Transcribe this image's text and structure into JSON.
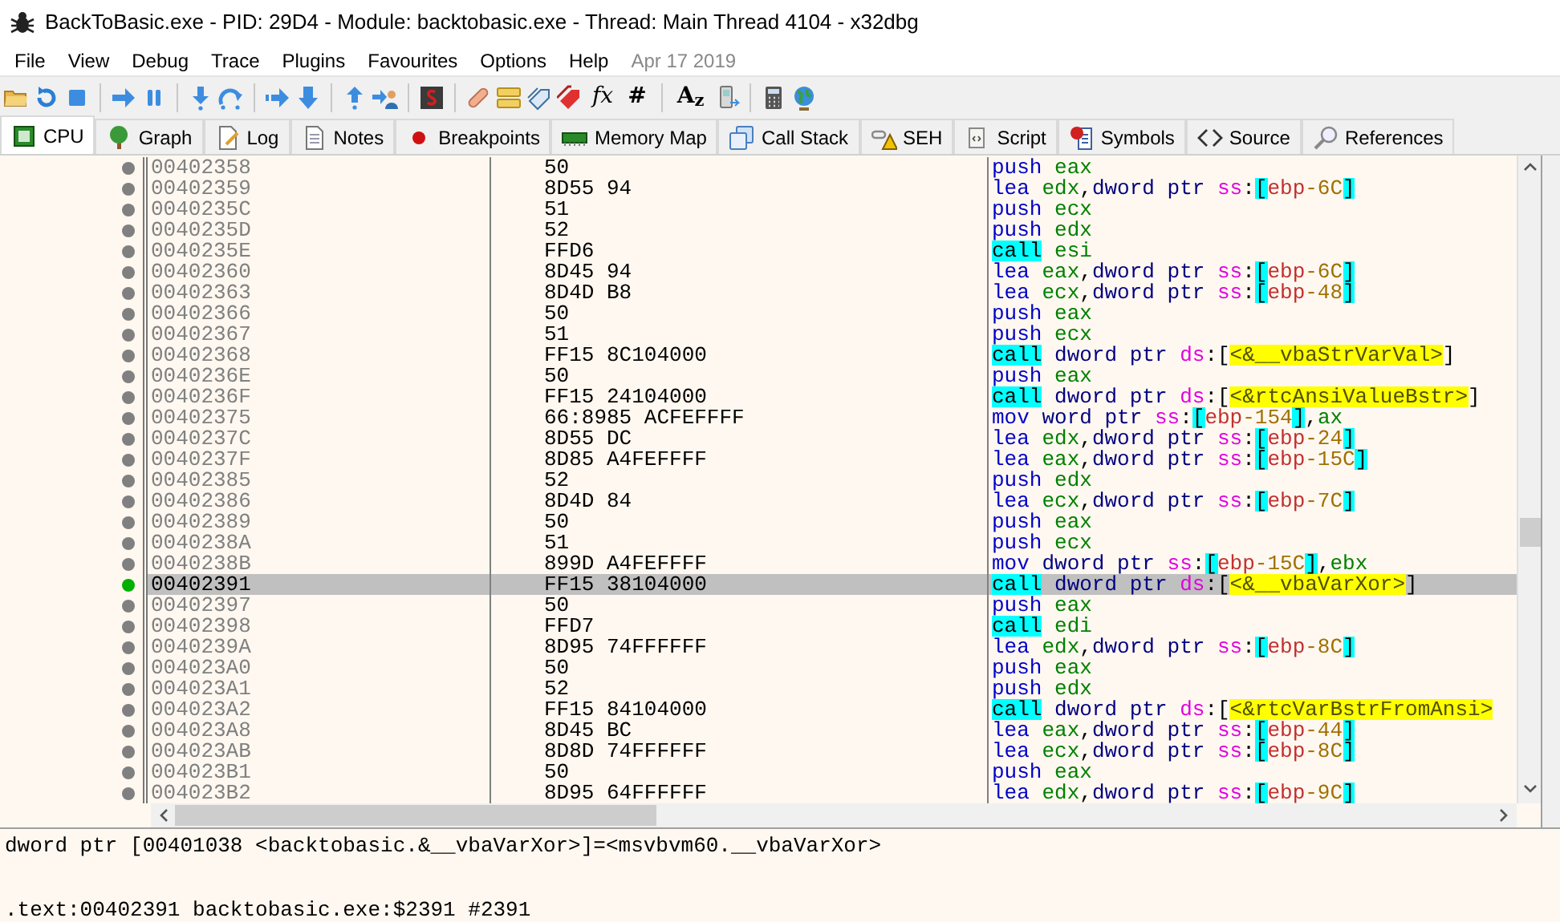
{
  "window": {
    "title": "BackToBasic.exe - PID: 29D4 - Module: backtobasic.exe - Thread: Main Thread 4104 - x32dbg"
  },
  "menu": [
    "File",
    "View",
    "Debug",
    "Trace",
    "Plugins",
    "Favourites",
    "Options",
    "Help"
  ],
  "build_date": "Apr 17 2019",
  "toolbar_text_buttons": [
    "fx",
    "#",
    "A$_{z}$"
  ],
  "tabs": [
    {
      "label": "CPU",
      "selected": true
    },
    {
      "label": "Graph",
      "selected": false
    },
    {
      "label": "Log",
      "selected": false
    },
    {
      "label": "Notes",
      "selected": false
    },
    {
      "label": "Breakpoints",
      "selected": false
    },
    {
      "label": "Memory Map",
      "selected": false
    },
    {
      "label": "Call Stack",
      "selected": false
    },
    {
      "label": "SEH",
      "selected": false
    },
    {
      "label": "Script",
      "selected": false
    },
    {
      "label": "Symbols",
      "selected": false
    },
    {
      "label": "Source",
      "selected": false
    },
    {
      "label": "References",
      "selected": false
    }
  ],
  "disassembly": {
    "rows": [
      {
        "address": "00402358",
        "bytes": "50",
        "current": false,
        "instruction": [
          [
            {
              "kind": "mn",
              "text": "push"
            }
          ],
          [
            {
              "kind": "reg",
              "text": "eax"
            }
          ]
        ]
      },
      {
        "address": "00402359",
        "bytes": "8D55 94",
        "current": false,
        "instruction": [
          [
            {
              "kind": "mn",
              "text": "lea"
            }
          ],
          [
            {
              "kind": "reg",
              "text": "edx"
            },
            {
              "kind": "p",
              "text": ","
            },
            {
              "kind": "sz",
              "text": "dword"
            }
          ],
          [
            {
              "kind": "sz",
              "text": "ptr"
            }
          ],
          [
            {
              "kind": "seg",
              "text": "ss"
            },
            {
              "kind": "p",
              "text": ":"
            },
            {
              "kind": "bk",
              "text": "["
            },
            {
              "kind": "base",
              "text": "ebp"
            },
            {
              "kind": "disp",
              "text": "-6C"
            },
            {
              "kind": "bk",
              "text": "]"
            }
          ]
        ]
      },
      {
        "address": "0040235C",
        "bytes": "51",
        "current": false,
        "instruction": [
          [
            {
              "kind": "mn",
              "text": "push"
            }
          ],
          [
            {
              "kind": "reg",
              "text": "ecx"
            }
          ]
        ]
      },
      {
        "address": "0040235D",
        "bytes": "52",
        "current": false,
        "instruction": [
          [
            {
              "kind": "mn",
              "text": "push"
            }
          ],
          [
            {
              "kind": "reg",
              "text": "edx"
            }
          ]
        ]
      },
      {
        "address": "0040235E",
        "bytes": "FFD6",
        "current": false,
        "instruction": [
          [
            {
              "kind": "call",
              "text": "call"
            }
          ],
          [
            {
              "kind": "reg",
              "text": "esi"
            }
          ]
        ]
      },
      {
        "address": "00402360",
        "bytes": "8D45 94",
        "current": false,
        "instruction": [
          [
            {
              "kind": "mn",
              "text": "lea"
            }
          ],
          [
            {
              "kind": "reg",
              "text": "eax"
            },
            {
              "kind": "p",
              "text": ","
            },
            {
              "kind": "sz",
              "text": "dword"
            }
          ],
          [
            {
              "kind": "sz",
              "text": "ptr"
            }
          ],
          [
            {
              "kind": "seg",
              "text": "ss"
            },
            {
              "kind": "p",
              "text": ":"
            },
            {
              "kind": "bk",
              "text": "["
            },
            {
              "kind": "base",
              "text": "ebp"
            },
            {
              "kind": "disp",
              "text": "-6C"
            },
            {
              "kind": "bk",
              "text": "]"
            }
          ]
        ]
      },
      {
        "address": "00402363",
        "bytes": "8D4D B8",
        "current": false,
        "instruction": [
          [
            {
              "kind": "mn",
              "text": "lea"
            }
          ],
          [
            {
              "kind": "reg",
              "text": "ecx"
            },
            {
              "kind": "p",
              "text": ","
            },
            {
              "kind": "sz",
              "text": "dword"
            }
          ],
          [
            {
              "kind": "sz",
              "text": "ptr"
            }
          ],
          [
            {
              "kind": "seg",
              "text": "ss"
            },
            {
              "kind": "p",
              "text": ":"
            },
            {
              "kind": "bk",
              "text": "["
            },
            {
              "kind": "base",
              "text": "ebp"
            },
            {
              "kind": "disp",
              "text": "-48"
            },
            {
              "kind": "bk",
              "text": "]"
            }
          ]
        ]
      },
      {
        "address": "00402366",
        "bytes": "50",
        "current": false,
        "instruction": [
          [
            {
              "kind": "mn",
              "text": "push"
            }
          ],
          [
            {
              "kind": "reg",
              "text": "eax"
            }
          ]
        ]
      },
      {
        "address": "00402367",
        "bytes": "51",
        "current": false,
        "instruction": [
          [
            {
              "kind": "mn",
              "text": "push"
            }
          ],
          [
            {
              "kind": "reg",
              "text": "ecx"
            }
          ]
        ]
      },
      {
        "address": "00402368",
        "bytes": "FF15 8C104000",
        "current": false,
        "instruction": [
          [
            {
              "kind": "call",
              "text": "call"
            }
          ],
          [
            {
              "kind": "sz",
              "text": "dword"
            }
          ],
          [
            {
              "kind": "sz",
              "text": "ptr"
            }
          ],
          [
            {
              "kind": "seg",
              "text": "ds"
            },
            {
              "kind": "p",
              "text": ":["
            },
            {
              "kind": "lbl",
              "text": "<&__vbaStrVarVal>"
            },
            {
              "kind": "p",
              "text": "]"
            }
          ]
        ]
      },
      {
        "address": "0040236E",
        "bytes": "50",
        "current": false,
        "instruction": [
          [
            {
              "kind": "mn",
              "text": "push"
            }
          ],
          [
            {
              "kind": "reg",
              "text": "eax"
            }
          ]
        ]
      },
      {
        "address": "0040236F",
        "bytes": "FF15 24104000",
        "current": false,
        "instruction": [
          [
            {
              "kind": "call",
              "text": "call"
            }
          ],
          [
            {
              "kind": "sz",
              "text": "dword"
            }
          ],
          [
            {
              "kind": "sz",
              "text": "ptr"
            }
          ],
          [
            {
              "kind": "seg",
              "text": "ds"
            },
            {
              "kind": "p",
              "text": ":["
            },
            {
              "kind": "lbl",
              "text": "<&rtcAnsiValueBstr>"
            },
            {
              "kind": "p",
              "text": "]"
            }
          ]
        ]
      },
      {
        "address": "00402375",
        "bytes": "66:8985 ACFEFFFF",
        "current": false,
        "instruction": [
          [
            {
              "kind": "mn",
              "text": "mov"
            }
          ],
          [
            {
              "kind": "sz",
              "text": "word"
            }
          ],
          [
            {
              "kind": "sz",
              "text": "ptr"
            }
          ],
          [
            {
              "kind": "seg",
              "text": "ss"
            },
            {
              "kind": "p",
              "text": ":"
            },
            {
              "kind": "bk",
              "text": "["
            },
            {
              "kind": "base",
              "text": "ebp"
            },
            {
              "kind": "disp",
              "text": "-154"
            },
            {
              "kind": "bk",
              "text": "]"
            },
            {
              "kind": "p",
              "text": ","
            },
            {
              "kind": "reg",
              "text": "ax"
            }
          ]
        ]
      },
      {
        "address": "0040237C",
        "bytes": "8D55 DC",
        "current": false,
        "instruction": [
          [
            {
              "kind": "mn",
              "text": "lea"
            }
          ],
          [
            {
              "kind": "reg",
              "text": "edx"
            },
            {
              "kind": "p",
              "text": ","
            },
            {
              "kind": "sz",
              "text": "dword"
            }
          ],
          [
            {
              "kind": "sz",
              "text": "ptr"
            }
          ],
          [
            {
              "kind": "seg",
              "text": "ss"
            },
            {
              "kind": "p",
              "text": ":"
            },
            {
              "kind": "bk",
              "text": "["
            },
            {
              "kind": "base",
              "text": "ebp"
            },
            {
              "kind": "disp",
              "text": "-24"
            },
            {
              "kind": "bk",
              "text": "]"
            }
          ]
        ]
      },
      {
        "address": "0040237F",
        "bytes": "8D85 A4FEFFFF",
        "current": false,
        "instruction": [
          [
            {
              "kind": "mn",
              "text": "lea"
            }
          ],
          [
            {
              "kind": "reg",
              "text": "eax"
            },
            {
              "kind": "p",
              "text": ","
            },
            {
              "kind": "sz",
              "text": "dword"
            }
          ],
          [
            {
              "kind": "sz",
              "text": "ptr"
            }
          ],
          [
            {
              "kind": "seg",
              "text": "ss"
            },
            {
              "kind": "p",
              "text": ":"
            },
            {
              "kind": "bk",
              "text": "["
            },
            {
              "kind": "base",
              "text": "ebp"
            },
            {
              "kind": "disp",
              "text": "-15C"
            },
            {
              "kind": "bk",
              "text": "]"
            }
          ]
        ]
      },
      {
        "address": "00402385",
        "bytes": "52",
        "current": false,
        "instruction": [
          [
            {
              "kind": "mn",
              "text": "push"
            }
          ],
          [
            {
              "kind": "reg",
              "text": "edx"
            }
          ]
        ]
      },
      {
        "address": "00402386",
        "bytes": "8D4D 84",
        "current": false,
        "instruction": [
          [
            {
              "kind": "mn",
              "text": "lea"
            }
          ],
          [
            {
              "kind": "reg",
              "text": "ecx"
            },
            {
              "kind": "p",
              "text": ","
            },
            {
              "kind": "sz",
              "text": "dword"
            }
          ],
          [
            {
              "kind": "sz",
              "text": "ptr"
            }
          ],
          [
            {
              "kind": "seg",
              "text": "ss"
            },
            {
              "kind": "p",
              "text": ":"
            },
            {
              "kind": "bk",
              "text": "["
            },
            {
              "kind": "base",
              "text": "ebp"
            },
            {
              "kind": "disp",
              "text": "-7C"
            },
            {
              "kind": "bk",
              "text": "]"
            }
          ]
        ]
      },
      {
        "address": "00402389",
        "bytes": "50",
        "current": false,
        "instruction": [
          [
            {
              "kind": "mn",
              "text": "push"
            }
          ],
          [
            {
              "kind": "reg",
              "text": "eax"
            }
          ]
        ]
      },
      {
        "address": "0040238A",
        "bytes": "51",
        "current": false,
        "instruction": [
          [
            {
              "kind": "mn",
              "text": "push"
            }
          ],
          [
            {
              "kind": "reg",
              "text": "ecx"
            }
          ]
        ]
      },
      {
        "address": "0040238B",
        "bytes": "899D A4FEFFFF",
        "current": false,
        "instruction": [
          [
            {
              "kind": "mn",
              "text": "mov"
            }
          ],
          [
            {
              "kind": "sz",
              "text": "dword"
            }
          ],
          [
            {
              "kind": "sz",
              "text": "ptr"
            }
          ],
          [
            {
              "kind": "seg",
              "text": "ss"
            },
            {
              "kind": "p",
              "text": ":"
            },
            {
              "kind": "bk",
              "text": "["
            },
            {
              "kind": "base",
              "text": "ebp"
            },
            {
              "kind": "disp",
              "text": "-15C"
            },
            {
              "kind": "bk",
              "text": "]"
            },
            {
              "kind": "p",
              "text": ","
            },
            {
              "kind": "reg",
              "text": "ebx"
            }
          ]
        ]
      },
      {
        "address": "00402391",
        "bytes": "FF15 38104000",
        "current": true,
        "instruction": [
          [
            {
              "kind": "call",
              "text": "call"
            }
          ],
          [
            {
              "kind": "sz",
              "text": "dword"
            }
          ],
          [
            {
              "kind": "sz",
              "text": "ptr"
            }
          ],
          [
            {
              "kind": "seg",
              "text": "ds"
            },
            {
              "kind": "p",
              "text": ":["
            },
            {
              "kind": "lbl",
              "text": "<&__vbaVarXor>"
            },
            {
              "kind": "p",
              "text": "]"
            }
          ]
        ]
      },
      {
        "address": "00402397",
        "bytes": "50",
        "current": false,
        "instruction": [
          [
            {
              "kind": "mn",
              "text": "push"
            }
          ],
          [
            {
              "kind": "reg",
              "text": "eax"
            }
          ]
        ]
      },
      {
        "address": "00402398",
        "bytes": "FFD7",
        "current": false,
        "instruction": [
          [
            {
              "kind": "call",
              "text": "call"
            }
          ],
          [
            {
              "kind": "reg",
              "text": "edi"
            }
          ]
        ]
      },
      {
        "address": "0040239A",
        "bytes": "8D95 74FFFFFF",
        "current": false,
        "instruction": [
          [
            {
              "kind": "mn",
              "text": "lea"
            }
          ],
          [
            {
              "kind": "reg",
              "text": "edx"
            },
            {
              "kind": "p",
              "text": ","
            },
            {
              "kind": "sz",
              "text": "dword"
            }
          ],
          [
            {
              "kind": "sz",
              "text": "ptr"
            }
          ],
          [
            {
              "kind": "seg",
              "text": "ss"
            },
            {
              "kind": "p",
              "text": ":"
            },
            {
              "kind": "bk",
              "text": "["
            },
            {
              "kind": "base",
              "text": "ebp"
            },
            {
              "kind": "disp",
              "text": "-8C"
            },
            {
              "kind": "bk",
              "text": "]"
            }
          ]
        ]
      },
      {
        "address": "004023A0",
        "bytes": "50",
        "current": false,
        "instruction": [
          [
            {
              "kind": "mn",
              "text": "push"
            }
          ],
          [
            {
              "kind": "reg",
              "text": "eax"
            }
          ]
        ]
      },
      {
        "address": "004023A1",
        "bytes": "52",
        "current": false,
        "instruction": [
          [
            {
              "kind": "mn",
              "text": "push"
            }
          ],
          [
            {
              "kind": "reg",
              "text": "edx"
            }
          ]
        ]
      },
      {
        "address": "004023A2",
        "bytes": "FF15 84104000",
        "current": false,
        "instruction": [
          [
            {
              "kind": "call",
              "text": "call"
            }
          ],
          [
            {
              "kind": "sz",
              "text": "dword"
            }
          ],
          [
            {
              "kind": "sz",
              "text": "ptr"
            }
          ],
          [
            {
              "kind": "seg",
              "text": "ds"
            },
            {
              "kind": "p",
              "text": ":["
            },
            {
              "kind": "lbl",
              "text": "<&rtcVarBstrFromAnsi>"
            }
          ]
        ]
      },
      {
        "address": "004023A8",
        "bytes": "8D45 BC",
        "current": false,
        "instruction": [
          [
            {
              "kind": "mn",
              "text": "lea"
            }
          ],
          [
            {
              "kind": "reg",
              "text": "eax"
            },
            {
              "kind": "p",
              "text": ","
            },
            {
              "kind": "sz",
              "text": "dword"
            }
          ],
          [
            {
              "kind": "sz",
              "text": "ptr"
            }
          ],
          [
            {
              "kind": "seg",
              "text": "ss"
            },
            {
              "kind": "p",
              "text": ":"
            },
            {
              "kind": "bk",
              "text": "["
            },
            {
              "kind": "base",
              "text": "ebp"
            },
            {
              "kind": "disp",
              "text": "-44"
            },
            {
              "kind": "bk",
              "text": "]"
            }
          ]
        ]
      },
      {
        "address": "004023AB",
        "bytes": "8D8D 74FFFFFF",
        "current": false,
        "instruction": [
          [
            {
              "kind": "mn",
              "text": "lea"
            }
          ],
          [
            {
              "kind": "reg",
              "text": "ecx"
            },
            {
              "kind": "p",
              "text": ","
            },
            {
              "kind": "sz",
              "text": "dword"
            }
          ],
          [
            {
              "kind": "sz",
              "text": "ptr"
            }
          ],
          [
            {
              "kind": "seg",
              "text": "ss"
            },
            {
              "kind": "p",
              "text": ":"
            },
            {
              "kind": "bk",
              "text": "["
            },
            {
              "kind": "base",
              "text": "ebp"
            },
            {
              "kind": "disp",
              "text": "-8C"
            },
            {
              "kind": "bk",
              "text": "]"
            }
          ]
        ]
      },
      {
        "address": "004023B1",
        "bytes": "50",
        "current": false,
        "instruction": [
          [
            {
              "kind": "mn",
              "text": "push"
            }
          ],
          [
            {
              "kind": "reg",
              "text": "eax"
            }
          ]
        ]
      },
      {
        "address": "004023B2",
        "bytes": "8D95 64FFFFFF",
        "current": false,
        "instruction": [
          [
            {
              "kind": "mn",
              "text": "lea"
            }
          ],
          [
            {
              "kind": "reg",
              "text": "edx"
            },
            {
              "kind": "p",
              "text": ","
            },
            {
              "kind": "sz",
              "text": "dword"
            }
          ],
          [
            {
              "kind": "sz",
              "text": "ptr"
            }
          ],
          [
            {
              "kind": "seg",
              "text": "ss"
            },
            {
              "kind": "p",
              "text": ":"
            },
            {
              "kind": "bk",
              "text": "["
            },
            {
              "kind": "base",
              "text": "ebp"
            },
            {
              "kind": "disp",
              "text": "-9C"
            },
            {
              "kind": "bk",
              "text": "]"
            }
          ]
        ]
      }
    ]
  },
  "info_lines": [
    "dword ptr [00401038 <backtobasic.&__vbaVarXor>]=<msvbvm60.__vbaVarXor>",
    ".text:00402391 backtobasic.exe:$2391 #2391"
  ]
}
